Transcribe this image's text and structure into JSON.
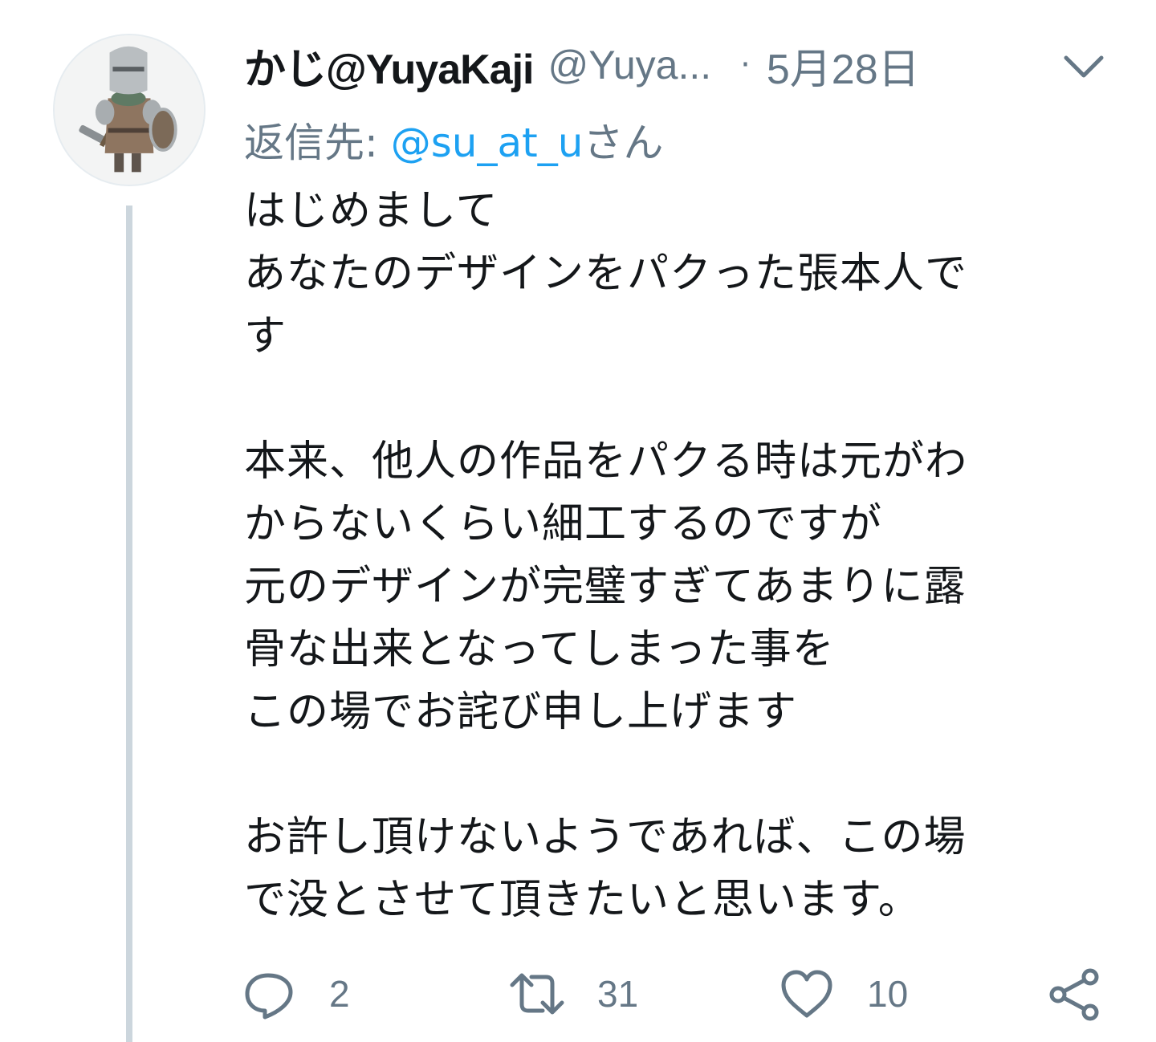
{
  "tweet": {
    "display_name": "かじ@YuyaKaji",
    "handle": "@Yuya...",
    "separator": "·",
    "date": "5月28日",
    "reply_prefix": "返信先: ",
    "reply_mention": "@su_at_u",
    "reply_suffix": "さん",
    "text": "はじめまして\nあなたのデザインをパクった張本人で\nす\n\n本来、他人の作品をパクる時は元がわ\nからないくらい細工するのですが\n元のデザインが完璧すぎてあまりに露\n骨な出来となってしまった事を\nこの場でお詫び申し上げます\n\nお許し頂けないようであれば、この場\nで没とさせて頂きたいと思います。"
  },
  "actions": {
    "reply": {
      "icon": "reply-icon",
      "count": "2"
    },
    "retweet": {
      "icon": "retweet-icon",
      "count": "31"
    },
    "like": {
      "icon": "heart-icon",
      "count": "10"
    },
    "share": {
      "icon": "share-icon"
    }
  },
  "colors": {
    "text": "#14171a",
    "secondary": "#657786",
    "link": "#1da1f2",
    "thread_line": "#ccd6dd"
  }
}
